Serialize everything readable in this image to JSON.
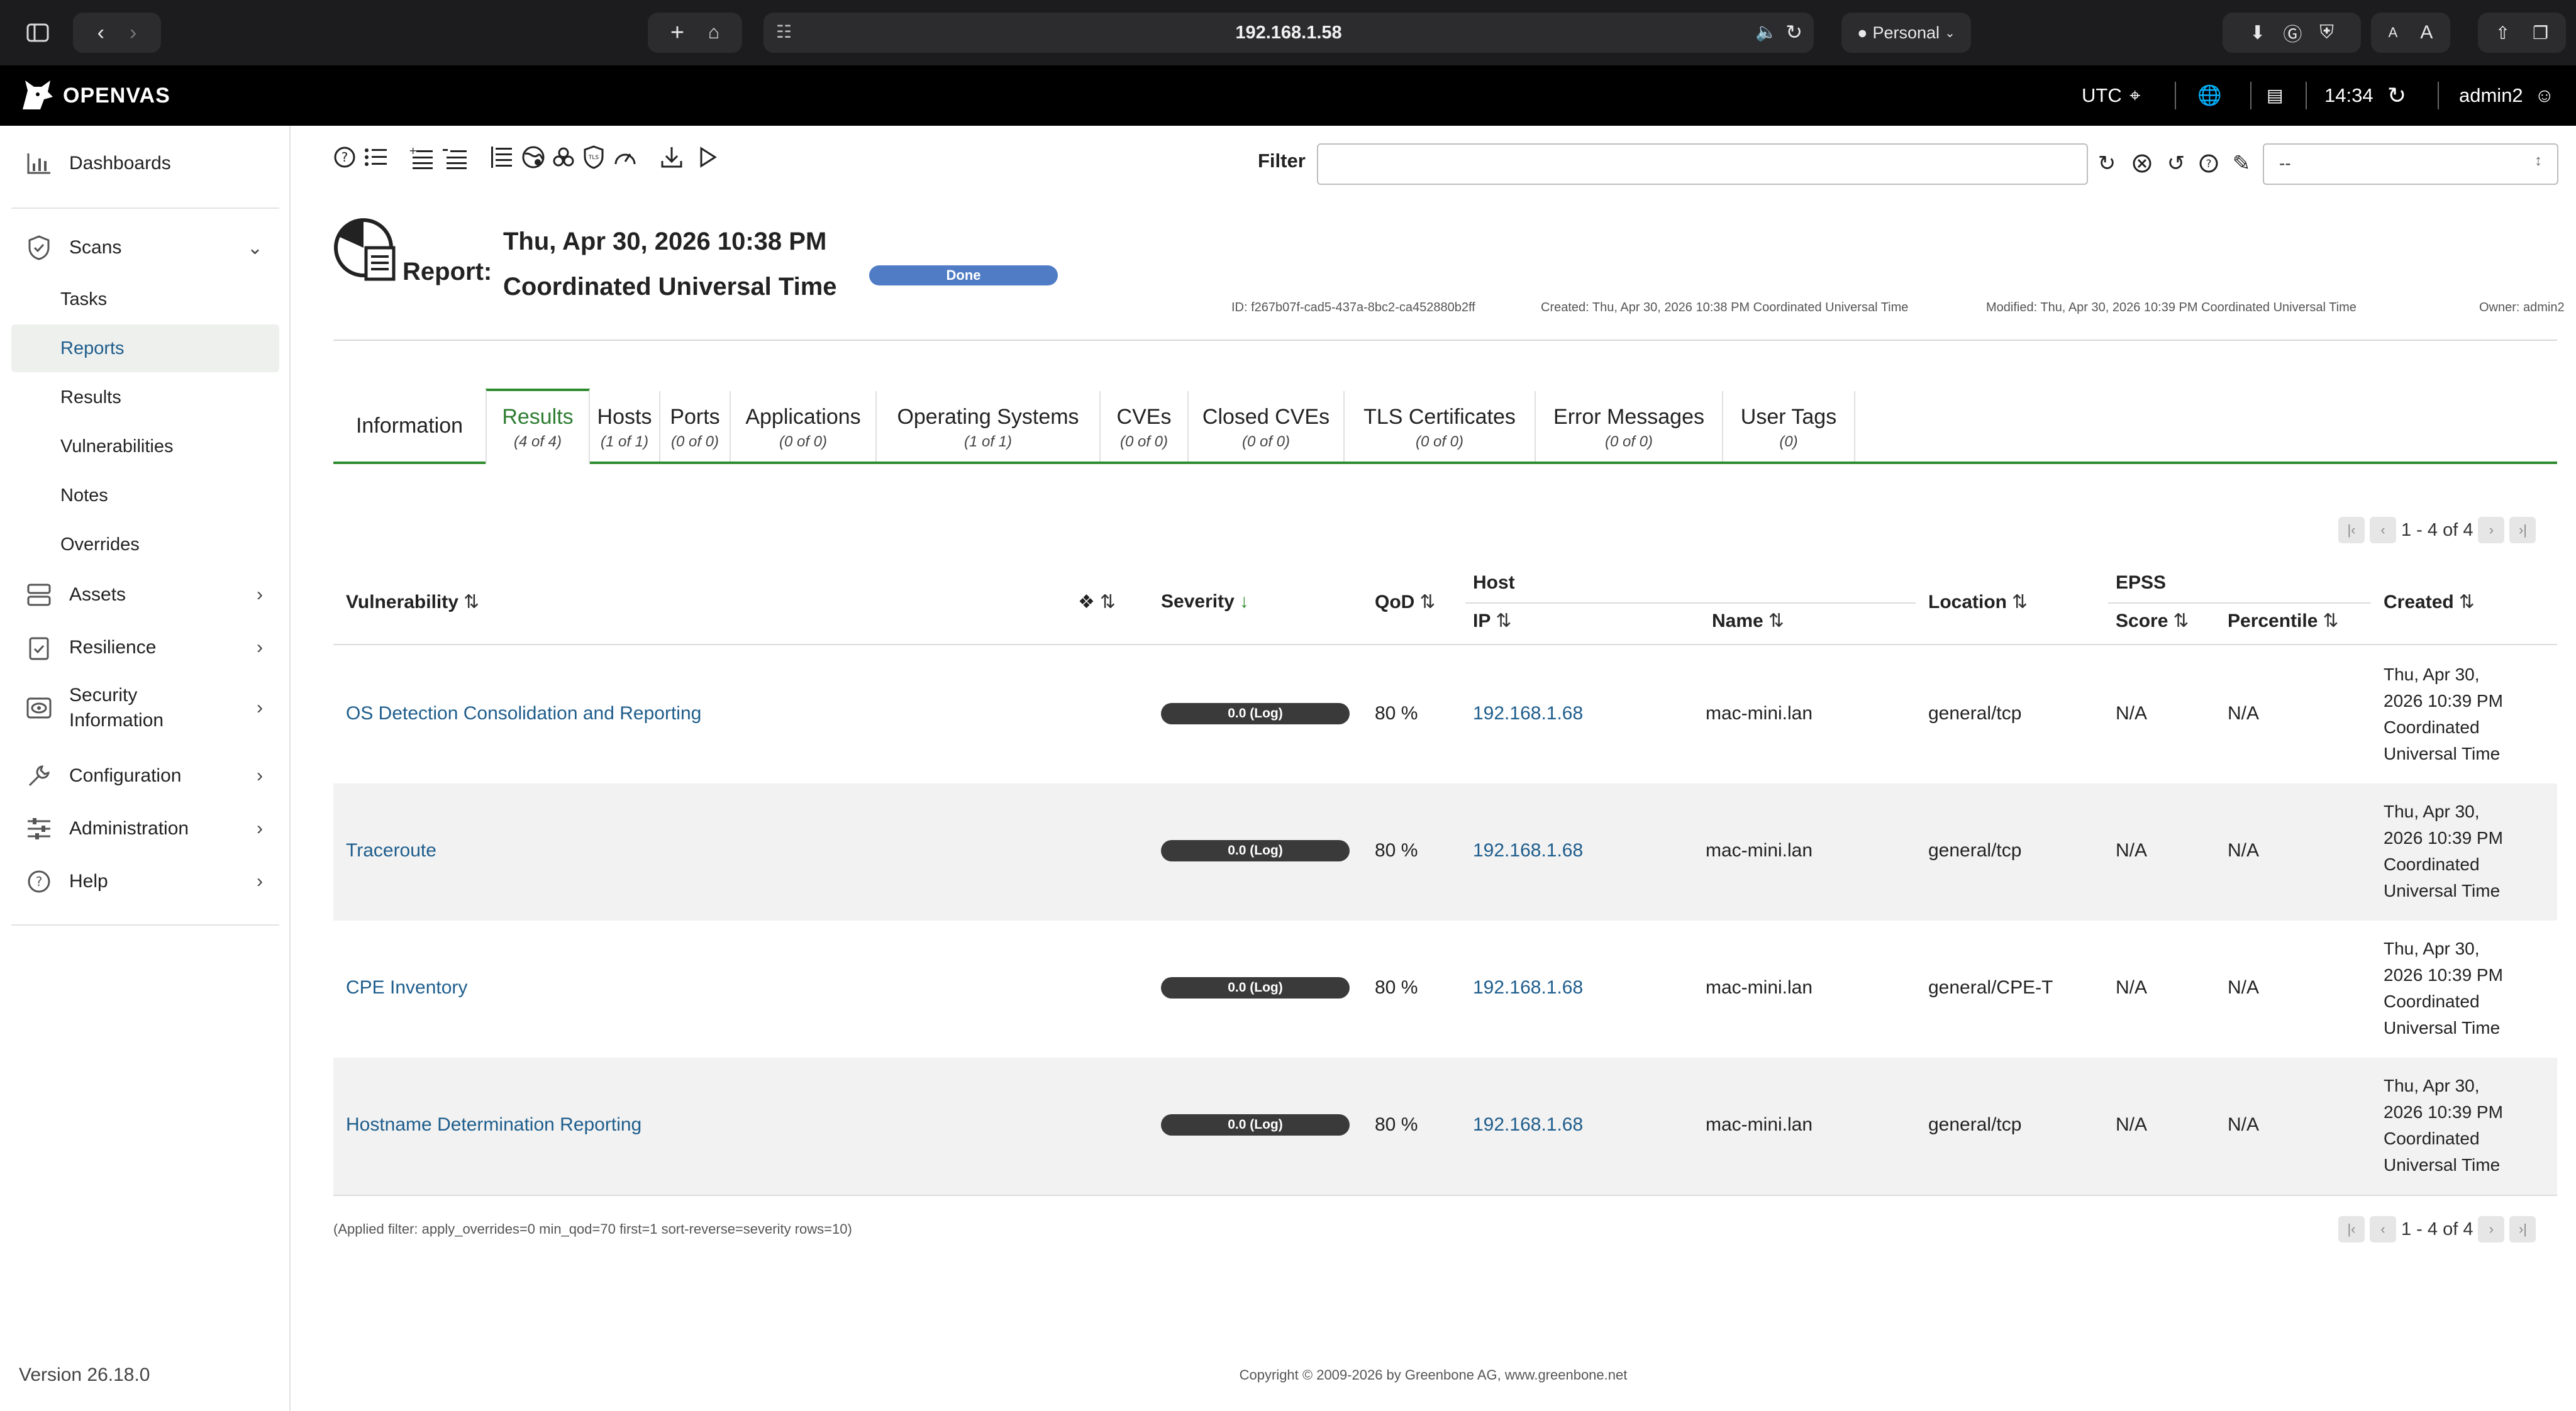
{
  "browser": {
    "url": "192.168.1.58",
    "profile": "Personal",
    "font_small": "A",
    "font_large": "A"
  },
  "header": {
    "brand": "OPENVAS",
    "timezone": "UTC",
    "time": "14:34",
    "user": "admin2"
  },
  "sidebar": {
    "dashboards": "Dashboards",
    "scans": "Scans",
    "scans_sub": [
      "Tasks",
      "Reports",
      "Results",
      "Vulnerabilities",
      "Notes",
      "Overrides"
    ],
    "assets": "Assets",
    "resilience": "Resilience",
    "security_line1": "Security",
    "security_line2": "Information",
    "configuration": "Configuration",
    "administration": "Administration",
    "help": "Help",
    "version": "Version 26.18.0"
  },
  "toolbar": {
    "filter_label": "Filter",
    "filter_value": "",
    "filter_select": "--"
  },
  "report": {
    "label": "Report:",
    "title_line1": "Thu, Apr 30, 2026 10:38 PM",
    "title_line2": "Coordinated Universal Time",
    "status": "Done",
    "id": "ID: f267b07f-cad5-437a-8bc2-ca452880b2ff",
    "created": "Created: Thu, Apr 30, 2026 10:38 PM Coordinated Universal Time",
    "modified": "Modified: Thu, Apr 30, 2026 10:39 PM Coordinated Universal Time",
    "owner": "Owner: admin2"
  },
  "tabs": [
    {
      "label": "Information",
      "count": ""
    },
    {
      "label": "Results",
      "count": "(4 of 4)"
    },
    {
      "label": "Hosts",
      "count": "(1 of 1)"
    },
    {
      "label": "Ports",
      "count": "(0 of 0)"
    },
    {
      "label": "Applications",
      "count": "(0 of 0)"
    },
    {
      "label": "Operating Systems",
      "count": "(1 of 1)"
    },
    {
      "label": "CVEs",
      "count": "(0 of 0)"
    },
    {
      "label": "Closed CVEs",
      "count": "(0 of 0)"
    },
    {
      "label": "TLS Certificates",
      "count": "(0 of 0)"
    },
    {
      "label": "Error Messages",
      "count": "(0 of 0)"
    },
    {
      "label": "User Tags",
      "count": "(0)"
    }
  ],
  "pagination": {
    "text": "1 - 4 of 4"
  },
  "table": {
    "headers": {
      "vulnerability": "Vulnerability",
      "severity": "Severity",
      "qod": "QoD",
      "host": "Host",
      "ip": "IP",
      "name": "Name",
      "location": "Location",
      "epss": "EPSS",
      "score": "Score",
      "percentile": "Percentile",
      "created": "Created"
    },
    "rows": [
      {
        "vulnerability": "OS Detection Consolidation and Reporting",
        "severity": "0.0 (Log)",
        "qod": "80 %",
        "ip": "192.168.1.68",
        "name": "mac-mini.lan",
        "location": "general/tcp",
        "score": "N/A",
        "percentile": "N/A",
        "created_1": "Thu, Apr 30,",
        "created_2": "2026 10:39 PM",
        "created_3": "Coordinated",
        "created_4": "Universal Time"
      },
      {
        "vulnerability": "Traceroute",
        "severity": "0.0 (Log)",
        "qod": "80 %",
        "ip": "192.168.1.68",
        "name": "mac-mini.lan",
        "location": "general/tcp",
        "score": "N/A",
        "percentile": "N/A",
        "created_1": "Thu, Apr 30,",
        "created_2": "2026 10:39 PM",
        "created_3": "Coordinated",
        "created_4": "Universal Time"
      },
      {
        "vulnerability": "CPE Inventory",
        "severity": "0.0 (Log)",
        "qod": "80 %",
        "ip": "192.168.1.68",
        "name": "mac-mini.lan",
        "location": "general/CPE-T",
        "score": "N/A",
        "percentile": "N/A",
        "created_1": "Thu, Apr 30,",
        "created_2": "2026 10:39 PM",
        "created_3": "Coordinated",
        "created_4": "Universal Time"
      },
      {
        "vulnerability": "Hostname Determination Reporting",
        "severity": "0.0 (Log)",
        "qod": "80 %",
        "ip": "192.168.1.68",
        "name": "mac-mini.lan",
        "location": "general/tcp",
        "score": "N/A",
        "percentile": "N/A",
        "created_1": "Thu, Apr 30,",
        "created_2": "2026 10:39 PM",
        "created_3": "Coordinated",
        "created_4": "Universal Time"
      }
    ]
  },
  "applied_filter": "(Applied filter: apply_overrides=0 min_qod=70 first=1 sort-reverse=severity rows=10)",
  "copyright": "Copyright © 2009-2026 by Greenbone AG, www.greenbone.net"
}
